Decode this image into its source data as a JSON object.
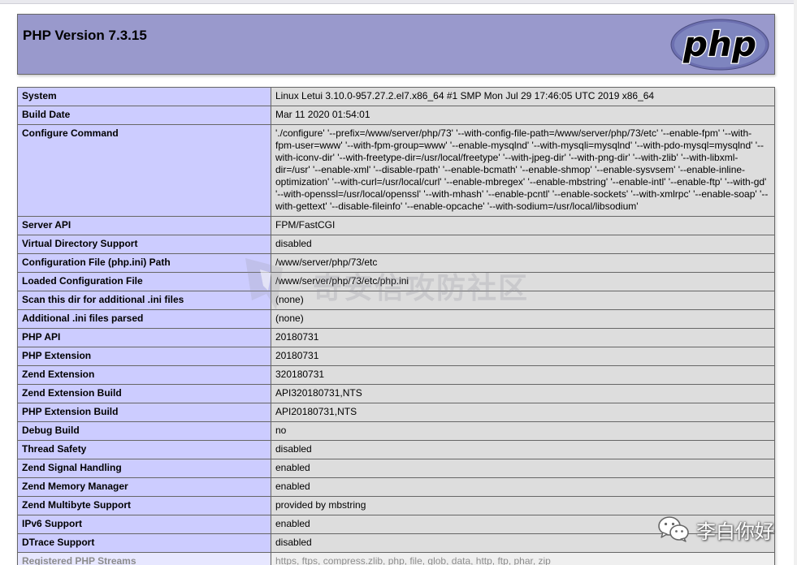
{
  "header": {
    "title": "PHP Version 7.3.15",
    "logo_text": "php"
  },
  "rows": [
    {
      "key": "System",
      "value": "Linux Letui 3.10.0-957.27.2.el7.x86_64 #1 SMP Mon Jul 29 17:46:05 UTC 2019 x86_64"
    },
    {
      "key": "Build Date",
      "value": "Mar 11 2020 01:54:01"
    },
    {
      "key": "Configure Command",
      "value": "'./configure' '--prefix=/www/server/php/73' '--with-config-file-path=/www/server/php/73/etc' '--enable-fpm' '--with-fpm-user=www' '--with-fpm-group=www' '--enable-mysqlnd' '--with-mysqli=mysqlnd' '--with-pdo-mysql=mysqlnd' '--with-iconv-dir' '--with-freetype-dir=/usr/local/freetype' '--with-jpeg-dir' '--with-png-dir' '--with-zlib' '--with-libxml-dir=/usr' '--enable-xml' '--disable-rpath' '--enable-bcmath' '--enable-shmop' '--enable-sysvsem' '--enable-inline-optimization' '--with-curl=/usr/local/curl' '--enable-mbregex' '--enable-mbstring' '--enable-intl' '--enable-ftp' '--with-gd' '--with-openssl=/usr/local/openssl' '--with-mhash' '--enable-pcntl' '--enable-sockets' '--with-xmlrpc' '--enable-soap' '--with-gettext' '--disable-fileinfo' '--enable-opcache' '--with-sodium=/usr/local/libsodium'"
    },
    {
      "key": "Server API",
      "value": "FPM/FastCGI"
    },
    {
      "key": "Virtual Directory Support",
      "value": "disabled"
    },
    {
      "key": "Configuration File (php.ini) Path",
      "value": "/www/server/php/73/etc"
    },
    {
      "key": "Loaded Configuration File",
      "value": "/www/server/php/73/etc/php.ini"
    },
    {
      "key": "Scan this dir for additional .ini files",
      "value": "(none)"
    },
    {
      "key": "Additional .ini files parsed",
      "value": "(none)"
    },
    {
      "key": "PHP API",
      "value": "20180731"
    },
    {
      "key": "PHP Extension",
      "value": "20180731"
    },
    {
      "key": "Zend Extension",
      "value": "320180731"
    },
    {
      "key": "Zend Extension Build",
      "value": "API320180731,NTS"
    },
    {
      "key": "PHP Extension Build",
      "value": "API20180731,NTS"
    },
    {
      "key": "Debug Build",
      "value": "no"
    },
    {
      "key": "Thread Safety",
      "value": "disabled"
    },
    {
      "key": "Zend Signal Handling",
      "value": "enabled"
    },
    {
      "key": "Zend Memory Manager",
      "value": "enabled"
    },
    {
      "key": "Zend Multibyte Support",
      "value": "provided by mbstring"
    },
    {
      "key": "IPv6 Support",
      "value": "enabled"
    },
    {
      "key": "DTrace Support",
      "value": "disabled"
    },
    {
      "key": "Registered PHP Streams",
      "value": "https, ftps, compress.zlib, php, file, glob, data, http, ftp, phar, zip"
    }
  ],
  "watermark": {
    "text": "奇安信攻防社区"
  },
  "wechat": {
    "name": "李白你好"
  },
  "colors": {
    "header_bg": "#9999cc",
    "key_bg": "#ccccff",
    "value_bg": "#dddddd",
    "border": "#666666"
  }
}
